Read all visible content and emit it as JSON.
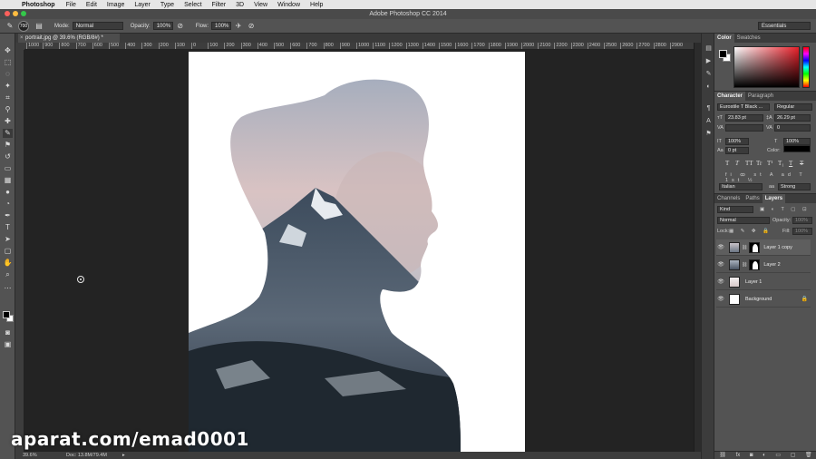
{
  "menubar": {
    "app_name": "Photoshop",
    "items": [
      "File",
      "Edit",
      "Image",
      "Layer",
      "Type",
      "Select",
      "Filter",
      "3D",
      "View",
      "Window",
      "Help"
    ]
  },
  "window": {
    "title": "Adobe Photoshop CC 2014"
  },
  "options": {
    "brush_size": "700",
    "mode_label": "Mode:",
    "mode_value": "Normal",
    "opacity_label": "Opacity:",
    "opacity_value": "100%",
    "flow_label": "Flow:",
    "flow_value": "100%",
    "workspace": "Essentials"
  },
  "document": {
    "tab_title": "portrait.jpg @ 39.6% (RGB/8#) *",
    "zoom": "39.6%",
    "doc_size": "Doc: 13.8M/79.4M"
  },
  "ruler_top_ticks": [
    "1000",
    "900",
    "800",
    "700",
    "600",
    "500",
    "400",
    "300",
    "200",
    "100",
    "0",
    "100",
    "200",
    "300",
    "400",
    "500",
    "600",
    "700",
    "800",
    "900",
    "1000",
    "1100",
    "1200",
    "1300",
    "1400",
    "1500",
    "1600",
    "1700",
    "1800",
    "1900",
    "2000",
    "2100",
    "2200",
    "2300",
    "2400",
    "2500",
    "2600",
    "2700",
    "2800",
    "2900"
  ],
  "color_panel": {
    "tabs": [
      "Color",
      "Swatches"
    ]
  },
  "character_panel": {
    "tabs": [
      "Character",
      "Paragraph"
    ],
    "font_family": "Eurostile T Black ...",
    "font_style": "Regular",
    "font_size": "23.83 pt",
    "leading": "26.29 pt",
    "kerning": "",
    "tracking": "0",
    "vertical_scale": "100%",
    "horizontal_scale": "100%",
    "baseline_shift": "0 pt",
    "color_label": "Color:",
    "type_buttons": [
      "T",
      "T",
      "TT",
      "Tr",
      "T¹",
      "T₁",
      "T",
      "T"
    ],
    "language": "Italian",
    "antialias": "Strong",
    "accent": "#000000"
  },
  "layers_panel": {
    "tabs": [
      "Channels",
      "Paths",
      "Layers"
    ],
    "filter": "Kind",
    "blend_mode": "Normal",
    "opacity_label": "Opacity:",
    "opacity_value": "100%",
    "lock_label": "Lock:",
    "fill_label": "Fill:",
    "fill_value": "100%",
    "layers": [
      {
        "name": "Layer 1 copy",
        "visible": true,
        "has_mask": true
      },
      {
        "name": "Layer 2",
        "visible": true,
        "has_mask": true
      },
      {
        "name": "Layer 1",
        "visible": true,
        "has_mask": false
      },
      {
        "name": "Background",
        "visible": true,
        "has_mask": false,
        "locked": true
      }
    ]
  },
  "watermark": "aparat.com/emad0001"
}
